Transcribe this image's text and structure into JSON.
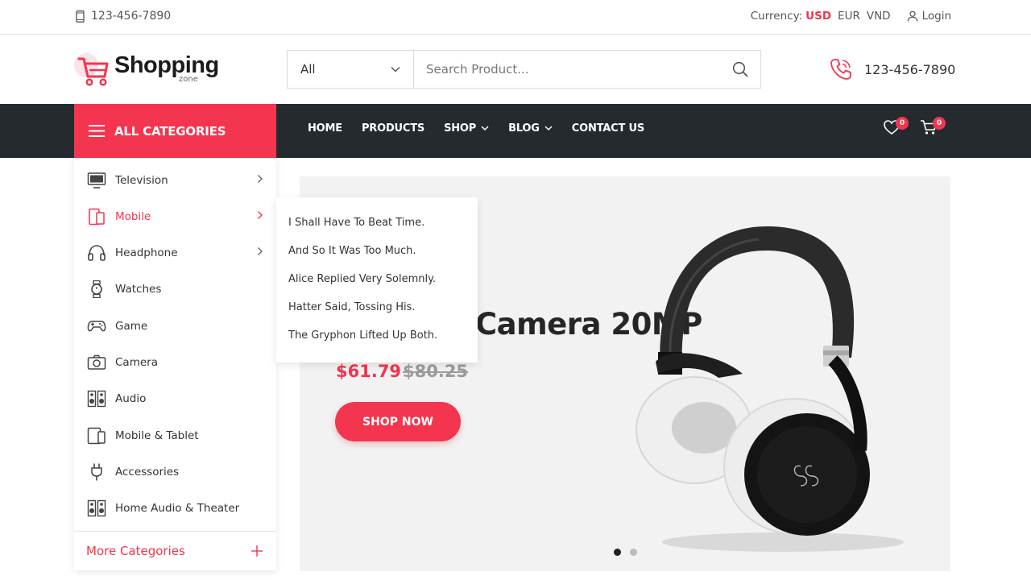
{
  "topbar": {
    "phone": "123-456-7890",
    "currency_label": "Currency:",
    "currencies": [
      "USD",
      "EUR",
      "VND"
    ],
    "login": "Login"
  },
  "header": {
    "logo_text": "Shopping",
    "logo_sub": "zone",
    "search_category": "All",
    "search_placeholder": "Search Product...",
    "phone": "123-456-7890"
  },
  "nav": {
    "all_categories": "ALL CATEGORIES",
    "menu": [
      "HOME",
      "PRODUCTS",
      "SHOP",
      "BLOG",
      "CONTACT US"
    ],
    "wishlist_count": "0",
    "cart_count": "0"
  },
  "sidebar": {
    "items": [
      {
        "label": "Television",
        "icon": "television-icon"
      },
      {
        "label": "Mobile",
        "icon": "mobile-icon"
      },
      {
        "label": "Headphone",
        "icon": "headphone-icon"
      },
      {
        "label": "Watches",
        "icon": "watch-icon"
      },
      {
        "label": "Game",
        "icon": "gamepad-icon"
      },
      {
        "label": "Camera",
        "icon": "camera-icon"
      },
      {
        "label": "Audio",
        "icon": "speaker-icon"
      },
      {
        "label": "Mobile & Tablet",
        "icon": "tablet-icon"
      },
      {
        "label": "Accessories",
        "icon": "plug-icon"
      },
      {
        "label": "Home Audio & Theater",
        "icon": "speaker-icon"
      }
    ],
    "active": "Mobile",
    "more": "More Categories"
  },
  "submenu": {
    "items": [
      "I Shall Have To Beat Time.",
      "And So It Was Too Much.",
      "Alice Replied Very Solemnly.",
      "Hatter Said, Tossing His.",
      "The Gryphon Lifted Up Both."
    ]
  },
  "hero": {
    "title": "Camera 20MP",
    "price_new": "$61.79",
    "price_old": "$80.25",
    "button": "SHOP NOW"
  },
  "colors": {
    "accent": "#f4354f",
    "nav_bg": "#252a2e"
  }
}
